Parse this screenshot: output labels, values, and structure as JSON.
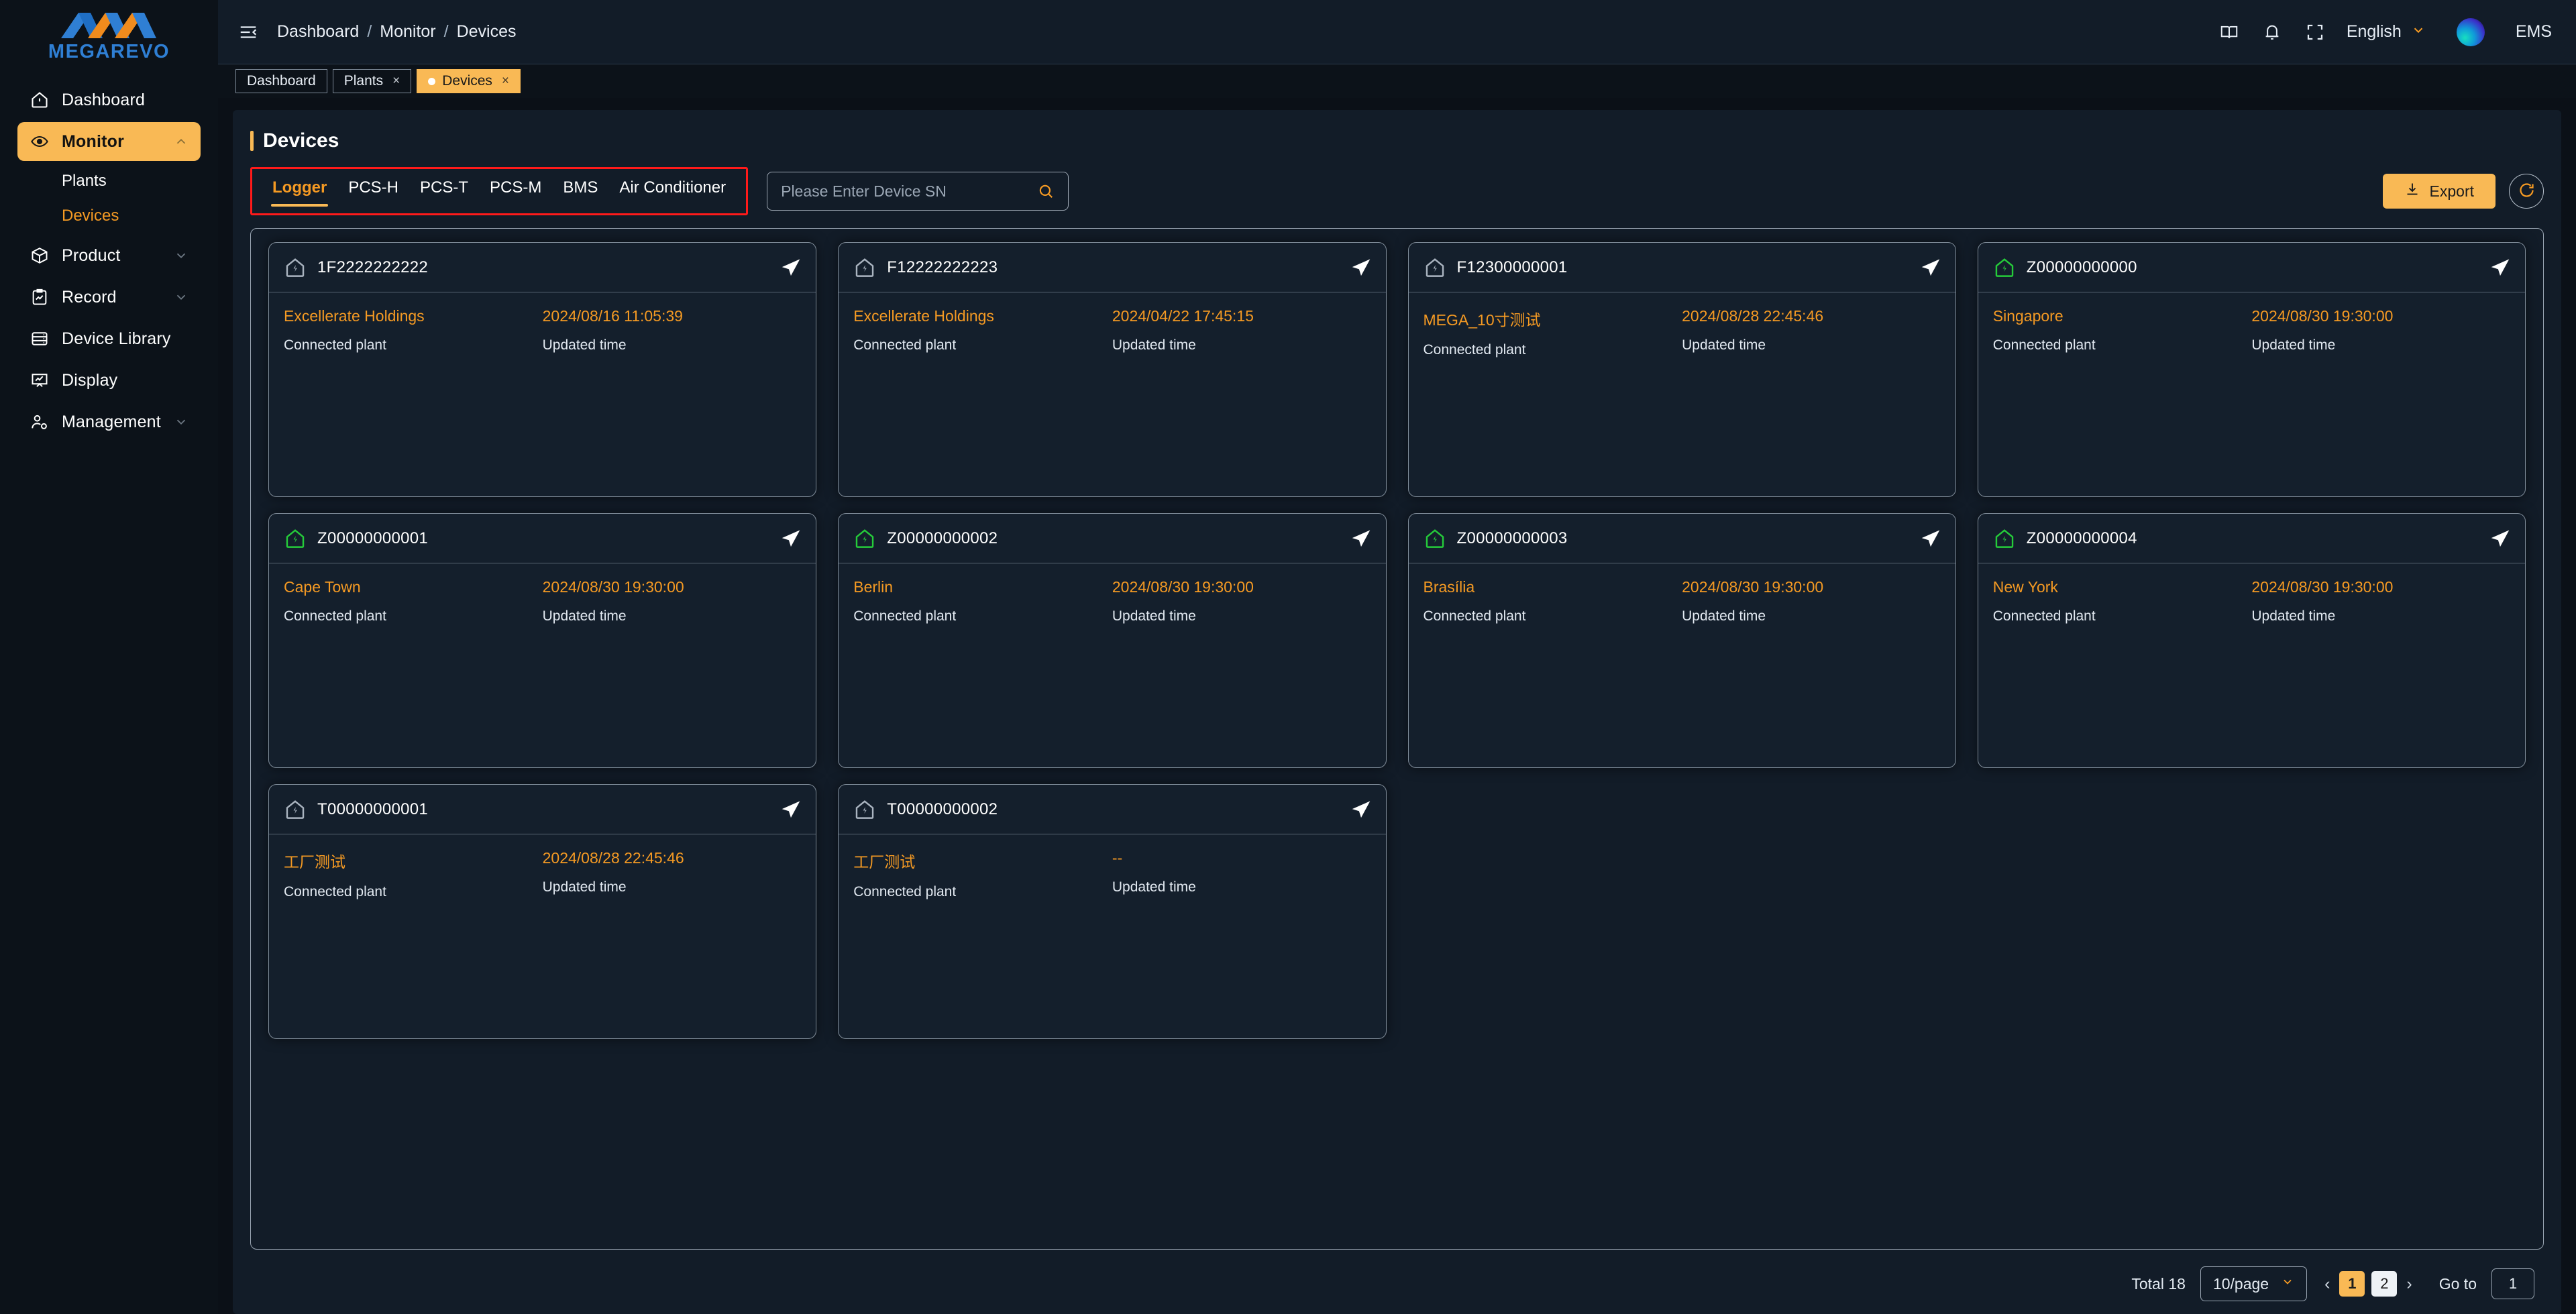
{
  "brand": {
    "name": "MEGAREVO",
    "accent": "#f9b955",
    "logo_blue": "#2f7fd4",
    "logo_orange": "#f08b1d"
  },
  "sidebar": {
    "items": [
      {
        "label": "Dashboard",
        "icon": "home-icon",
        "active": false,
        "expandable": false
      },
      {
        "label": "Monitor",
        "icon": "eye-icon",
        "active": true,
        "expandable": true
      },
      {
        "label": "Product",
        "icon": "box-icon",
        "active": false,
        "expandable": true
      },
      {
        "label": "Record",
        "icon": "clipboard-chart-icon",
        "active": false,
        "expandable": true
      },
      {
        "label": "Device Library",
        "icon": "server-icon",
        "active": false,
        "expandable": false
      },
      {
        "label": "Display",
        "icon": "presentation-chart-icon",
        "active": false,
        "expandable": false
      },
      {
        "label": "Management",
        "icon": "user-gear-icon",
        "active": false,
        "expandable": true
      }
    ],
    "sub_items": [
      {
        "label": "Plants",
        "active": false
      },
      {
        "label": "Devices",
        "active": true
      }
    ]
  },
  "topbar": {
    "collapse_icon": "collapse-sidebar-icon",
    "breadcrumb": [
      "Dashboard",
      "Monitor",
      "Devices"
    ],
    "separator": "/",
    "icons": [
      "book-icon",
      "bell-icon",
      "fullscreen-icon"
    ],
    "language": "English",
    "user_name": "EMS"
  },
  "page_tabs": [
    {
      "label": "Dashboard",
      "active": false,
      "closable": false,
      "dot": false
    },
    {
      "label": "Plants",
      "active": false,
      "closable": true,
      "dot": false
    },
    {
      "label": "Devices",
      "active": true,
      "closable": true,
      "dot": true
    }
  ],
  "page": {
    "title": "Devices"
  },
  "device_tabs": [
    {
      "label": "Logger",
      "active": true
    },
    {
      "label": "PCS-H",
      "active": false
    },
    {
      "label": "PCS-T",
      "active": false
    },
    {
      "label": "PCS-M",
      "active": false
    },
    {
      "label": "BMS",
      "active": false
    },
    {
      "label": "Air Conditioner",
      "active": false
    }
  ],
  "search": {
    "placeholder": "Please Enter Device SN",
    "value": "",
    "icon": "search-icon"
  },
  "toolbar": {
    "export_label": "Export",
    "export_icon": "download-icon",
    "refresh_icon": "refresh-icon"
  },
  "card_labels": {
    "connected_plant": "Connected plant",
    "updated_time": "Updated time"
  },
  "cards": [
    {
      "sn": "1F2222222222",
      "plant": "Excellerate Holdings",
      "updated": "2024/08/16 11:05:39",
      "status": "offline"
    },
    {
      "sn": "F12222222223",
      "plant": "Excellerate Holdings",
      "updated": "2024/04/22 17:45:15",
      "status": "offline"
    },
    {
      "sn": "F12300000001",
      "plant": "MEGA_10寸测试",
      "updated": "2024/08/28 22:45:46",
      "status": "offline"
    },
    {
      "sn": "Z00000000000",
      "plant": "Singapore",
      "updated": "2024/08/30 19:30:00",
      "status": "online"
    },
    {
      "sn": "Z00000000001",
      "plant": "Cape Town",
      "updated": "2024/08/30 19:30:00",
      "status": "online"
    },
    {
      "sn": "Z00000000002",
      "plant": "Berlin",
      "updated": "2024/08/30 19:30:00",
      "status": "online"
    },
    {
      "sn": "Z00000000003",
      "plant": "Brasília",
      "updated": "2024/08/30 19:30:00",
      "status": "online"
    },
    {
      "sn": "Z00000000004",
      "plant": "New York",
      "updated": "2024/08/30 19:30:00",
      "status": "online"
    },
    {
      "sn": "T00000000001",
      "plant": "工厂测试",
      "updated": "2024/08/28 22:45:46",
      "status": "offline"
    },
    {
      "sn": "T00000000002",
      "plant": "工厂测试",
      "updated": "--",
      "status": "offline"
    }
  ],
  "pagination": {
    "total_text": "Total 18",
    "page_size": "10/page",
    "prev": "‹",
    "next": "›",
    "pages": [
      {
        "label": "1",
        "state": "active"
      },
      {
        "label": "2",
        "state": "hover"
      }
    ],
    "goto_label": "Go to",
    "goto_value": "1"
  },
  "status_colors": {
    "online": "#25cc3a",
    "offline": "#aab4c0"
  }
}
